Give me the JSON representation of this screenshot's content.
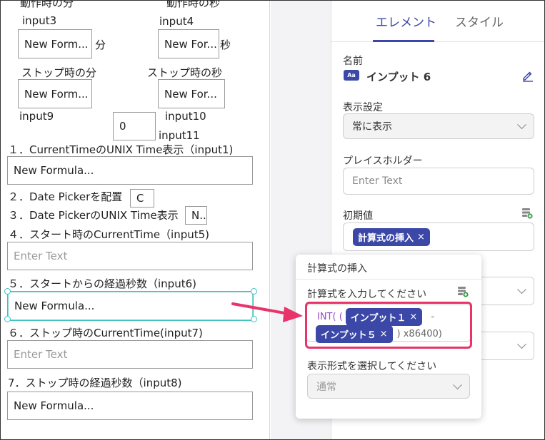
{
  "canvas": {
    "label_run_min": "動作時の分",
    "label_run_sec": "動作時の秒",
    "label_input3": "input3",
    "label_input4": "input4",
    "box_input3": "New Form...",
    "unit_min": "分",
    "box_input4": "New For...",
    "unit_sec": "秒",
    "label_stop_min": "ストップ時の分",
    "label_stop_sec": "ストップ時の秒",
    "box_input9": "New Form...",
    "box_input10": "New For...",
    "label_input9": "input9",
    "label_input10": "input10",
    "box_input11": "0",
    "label_input11": "input11",
    "line1_label": "１．CurrentTimeのUNIX Time表示（input1)",
    "line1_value": "New Formula...",
    "line2_label": "２．Date Pickerを配置",
    "line2_box": "C",
    "line3_label": "３．Date PickerのUNIX Time表示",
    "line3_box": "N..",
    "line4_label": "４．スタート時のCurrentTime（input5)",
    "line4_placeholder": "Enter Text",
    "line5_label": "５．スタートからの経過秒数（input6)",
    "line5_value": "New Formula...",
    "line6_label": "６．ストップ時のCurrentTime(input7)",
    "line6_placeholder": "Enter Text",
    "line7_label": "7．ストップ時の経過秒数（input8)",
    "line7_value": "New Formula..."
  },
  "panel": {
    "tab_element": "エレメント",
    "tab_style": "スタイル",
    "name_label": "名前",
    "name_icon_text": "Aa",
    "name_value": "インプット 6",
    "visibility_label": "表示設定",
    "visibility_value": "常に表示",
    "placeholder_label": "プレイスホルダー",
    "placeholder_value": "Enter Text",
    "initial_label": "初期値",
    "initial_chip": "計算式の挿入",
    "chip_close": "×"
  },
  "popup": {
    "title": "計算式の挿入",
    "formula_label": "計算式を入力してください",
    "fn_open": "INT( (",
    "chip1": "インプット１",
    "minus": "-",
    "chip2": "インプット５",
    "tail": ") x86400)",
    "format_label": "表示形式を選択してください",
    "format_value": "通常"
  },
  "colors": {
    "accent": "#3b48a8",
    "highlight": "#e8336b",
    "selection": "#3fc1c1"
  }
}
